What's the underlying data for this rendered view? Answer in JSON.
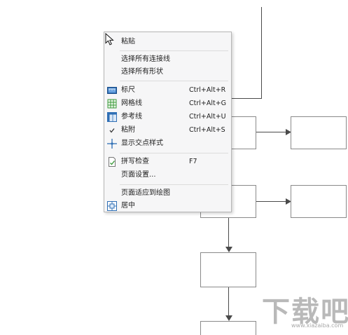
{
  "context_menu": {
    "items": [
      {
        "label": "粘贴",
        "shortcut": "",
        "icon": "paste-icon"
      },
      {
        "label": "选择所有连接线",
        "shortcut": "",
        "icon": ""
      },
      {
        "label": "选择所有形状",
        "shortcut": "",
        "icon": ""
      },
      {
        "label": "标尺",
        "shortcut": "Ctrl+Alt+R",
        "icon": "ruler-icon"
      },
      {
        "label": "网格线",
        "shortcut": "Ctrl+Alt+G",
        "icon": "grid-icon"
      },
      {
        "label": "参考线",
        "shortcut": "Ctrl+Alt+U",
        "icon": "guides-icon"
      },
      {
        "label": "粘附",
        "shortcut": "Ctrl+Alt+S",
        "icon": "checkmark-icon"
      },
      {
        "label": "显示交点样式",
        "shortcut": "",
        "icon": "crosshair-icon"
      },
      {
        "label": "拼写检查",
        "shortcut": "F7",
        "icon": "spellcheck-icon"
      },
      {
        "label": "页面设置...",
        "shortcut": "",
        "icon": ""
      },
      {
        "label": "页面适应到绘图",
        "shortcut": "",
        "icon": ""
      },
      {
        "label": "居中",
        "shortcut": "",
        "icon": "center-icon"
      }
    ]
  },
  "watermark": {
    "text": "下载吧",
    "url": "www.xiazaiba.com"
  },
  "colors": {
    "menu_bg": "#f6f6f7",
    "menu_border": "#b6b6b6",
    "icon_blue": "#2f6fb5",
    "icon_green": "#3c9a3c",
    "shape_border": "#8a8a8a",
    "connector": "#4a4a4a"
  }
}
